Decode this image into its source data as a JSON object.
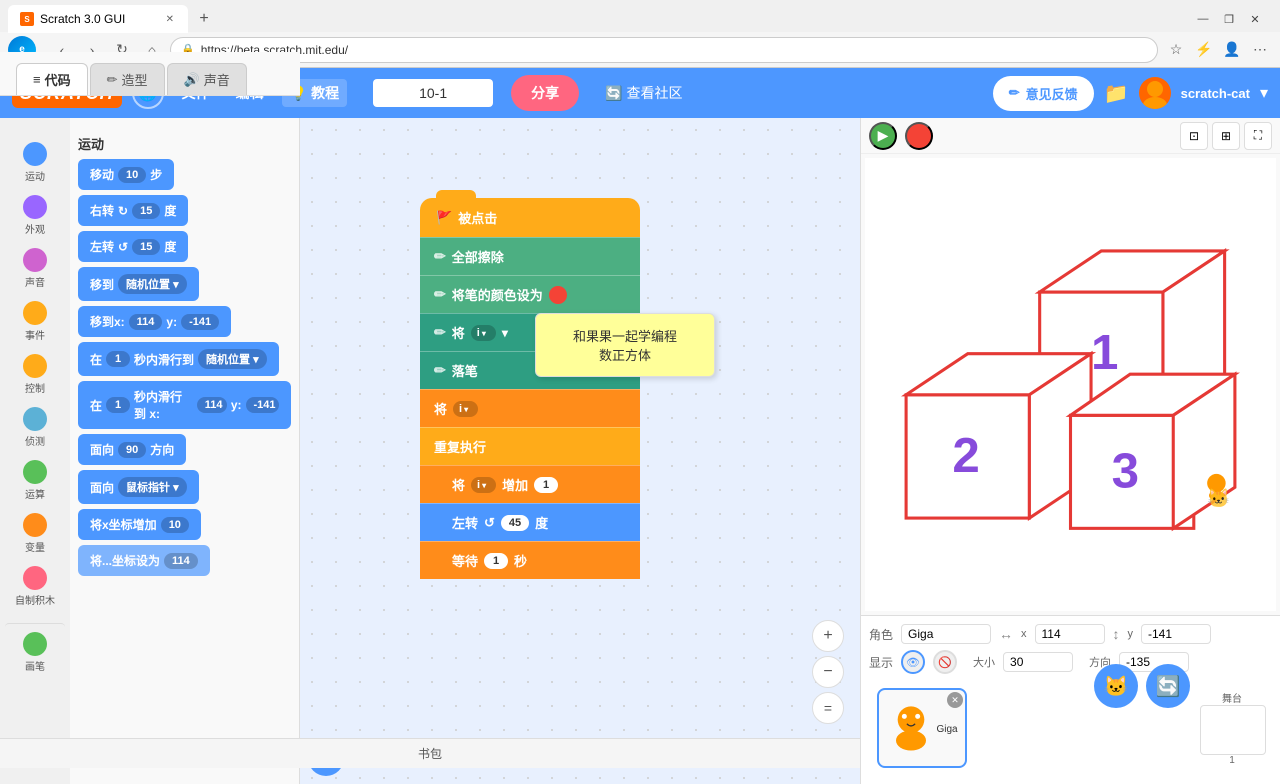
{
  "browser": {
    "tab_title": "Scratch 3.0 GUI",
    "url": "https://beta.scratch.mit.edu/",
    "new_tab_label": "+",
    "window_controls": [
      "—",
      "❐",
      "✕"
    ]
  },
  "scratch": {
    "logo": "SCRATCH",
    "header": {
      "globe_icon": "🌐",
      "menu_items": [
        "文件",
        "编辑"
      ],
      "tutorial_label": "教程",
      "project_name": "10-1",
      "share_btn": "分享",
      "community_btn": "查看社区",
      "feedback_btn": "意见反馈",
      "user_name": "scratch-cat"
    },
    "tabs": [
      {
        "label": "代码",
        "icon": "≡"
      },
      {
        "label": "造型",
        "icon": "✏"
      },
      {
        "label": "声音",
        "icon": "🔊"
      }
    ],
    "categories": [
      {
        "label": "运动",
        "color": "#4c97ff"
      },
      {
        "label": "外观",
        "color": "#9966ff"
      },
      {
        "label": "声音",
        "color": "#cf63cf"
      },
      {
        "label": "事件",
        "color": "#ffab19"
      },
      {
        "label": "控制",
        "color": "#ffab19"
      },
      {
        "label": "侦测",
        "color": "#5cb1d6"
      },
      {
        "label": "运算",
        "color": "#59c059"
      },
      {
        "label": "变量",
        "color": "#ff8c1a"
      },
      {
        "label": "自制积木",
        "color": "#ff6680"
      },
      {
        "label": "画笔",
        "color": "#59c059"
      }
    ],
    "motion_title": "运动",
    "blocks": [
      {
        "label": "移动",
        "param": "10",
        "suffix": "步",
        "type": "motion"
      },
      {
        "label": "右转",
        "param": "15",
        "suffix": "度",
        "type": "motion"
      },
      {
        "label": "左转",
        "param": "15",
        "suffix": "度",
        "type": "motion"
      },
      {
        "label": "移到",
        "param": "随机位置▾",
        "type": "motion"
      },
      {
        "label": "移到x:",
        "param1": "114",
        "param2": "-141",
        "type": "motion"
      },
      {
        "label": "在",
        "param1": "1",
        "mid": "秒内滑行到",
        "param2": "随机位置▾",
        "type": "motion"
      },
      {
        "label": "在",
        "param1": "1",
        "mid": "秒内滑行到 x:",
        "param2": "114",
        "param3": "-141",
        "type": "motion"
      },
      {
        "label": "面向",
        "param": "90",
        "suffix": "方向",
        "type": "motion"
      },
      {
        "label": "面向",
        "param": "鼠标指针▾",
        "type": "motion"
      },
      {
        "label": "将x坐标增加",
        "param": "10",
        "type": "motion"
      }
    ],
    "script_blocks": [
      {
        "type": "hat",
        "label": "当 🚩 被点击"
      },
      {
        "type": "pen-green",
        "icon": "✏",
        "label": "全部擦除"
      },
      {
        "type": "pen-green",
        "icon": "✏",
        "label": "将笔的颜色设为",
        "color_dot": true
      },
      {
        "type": "pen-teal",
        "icon": "✏",
        "label": "将"
      },
      {
        "type": "pen-teal",
        "icon": "✏",
        "label": "落笔"
      },
      {
        "type": "orange",
        "label": "将",
        "dropdown": "i",
        "label2": "▾"
      },
      {
        "type": "loop",
        "label": "重复执行"
      },
      {
        "type": "orange-inner",
        "label": "将",
        "dropdown": "i",
        "label2": "增加",
        "input": "1"
      },
      {
        "type": "blue-inner",
        "label": "左转",
        "icon": "↺",
        "input": "45",
        "suffix": "度"
      },
      {
        "type": "orange-inner2",
        "label": "等待",
        "input": "1",
        "suffix": "秒"
      }
    ],
    "tooltip": {
      "line1": "和果果一起学编程",
      "line2": "数正方体"
    },
    "sprite": {
      "name": "Giga",
      "x": "114",
      "y": "-141",
      "size": "30",
      "direction": "-135",
      "visible": true
    },
    "stage": {
      "background_count": "1",
      "label": "舞台"
    },
    "bottom_bar": "书包",
    "add_btn": "+",
    "zoom_in": "+",
    "zoom_out": "−",
    "zoom_equals": "="
  }
}
